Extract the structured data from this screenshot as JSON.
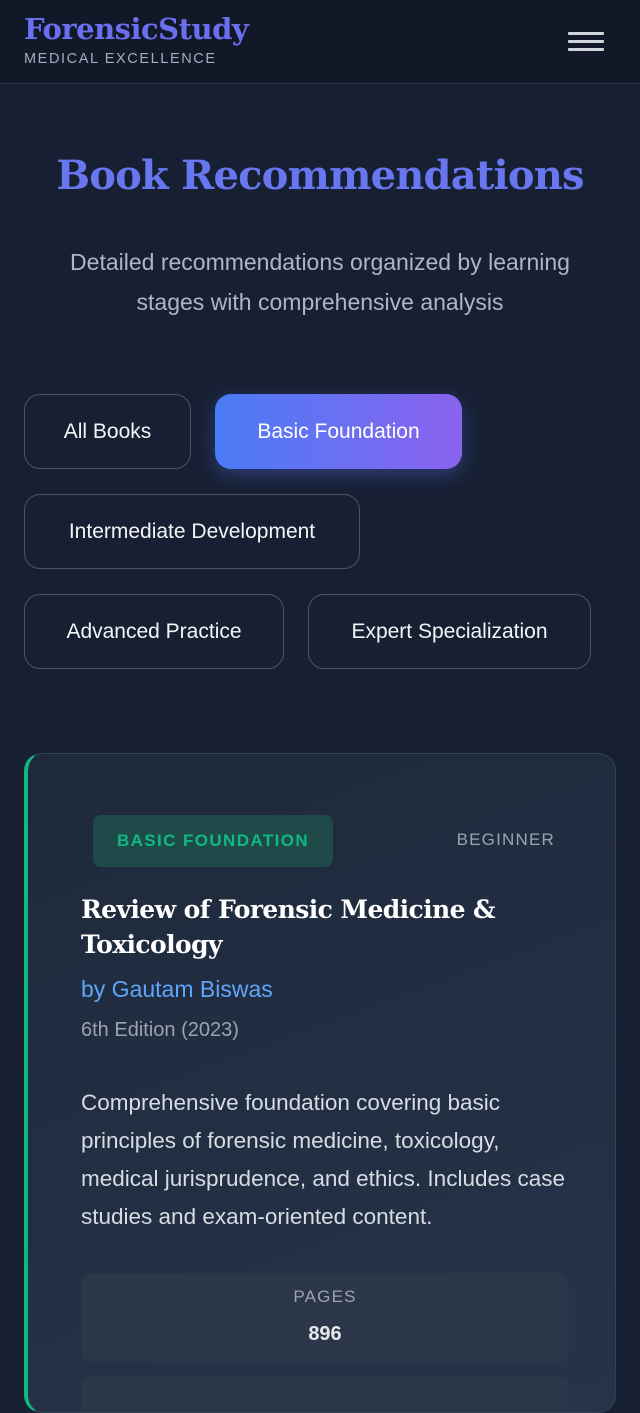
{
  "header": {
    "brand": "ForensicStudy",
    "tagline": "MEDICAL EXCELLENCE",
    "menu_icon": "hamburger-menu-icon"
  },
  "hero": {
    "title": "Book Recommendations",
    "subtitle": "Detailed recommendations organized by learning stages with comprehensive analysis"
  },
  "filters": {
    "active": "Basic Foundation",
    "items": [
      {
        "label": "All Books"
      },
      {
        "label": "Basic Foundation"
      },
      {
        "label": "Intermediate Development"
      },
      {
        "label": "Advanced Practice"
      },
      {
        "label": "Expert Specialization"
      }
    ]
  },
  "book": {
    "level": "BASIC FOUNDATION",
    "difficulty": "BEGINNER",
    "title": "Review of Forensic Medicine & Toxicology",
    "author": "by Gautam Biswas",
    "edition": "6th Edition (2023)",
    "description": "Comprehensive foundation covering basic principles of forensic medicine, toxicology, medical jurisprudence, and ethics. Includes case studies and exam-oriented content.",
    "stats": [
      {
        "label": "PAGES",
        "value": "896"
      }
    ]
  },
  "colors": {
    "background": "#172033",
    "brand": "#6a6ff0",
    "accent_gradient_start": "#4a7cf6",
    "accent_gradient_end": "#8a63ee",
    "level_green": "#10b981",
    "author_blue": "#60a5fa"
  }
}
